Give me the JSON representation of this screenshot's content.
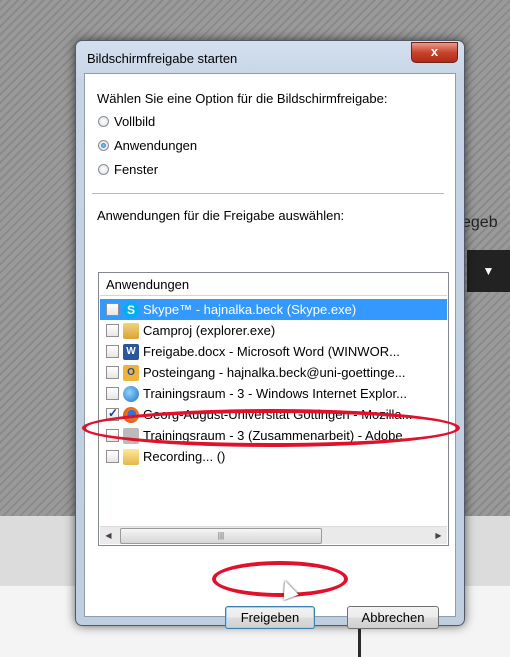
{
  "background": {
    "partial_label": "egeb"
  },
  "dialog": {
    "title": "Bildschirmfreigabe starten",
    "close_glyph": "x",
    "option_prompt": "Wählen Sie eine Option für die Bildschirmfreigabe:",
    "options": [
      {
        "label": "Vollbild",
        "selected": false
      },
      {
        "label": "Anwendungen",
        "selected": true
      },
      {
        "label": "Fenster",
        "selected": false
      }
    ],
    "apps_prompt": "Anwendungen für die Freigabe auswählen:",
    "list": {
      "header": "Anwendungen",
      "items": [
        {
          "label": "Skype™ - hajnalka.beck (Skype.exe)",
          "checked": false,
          "selected": true,
          "icon": "skype-icon"
        },
        {
          "label": "Camproj (explorer.exe)",
          "checked": false,
          "selected": false,
          "icon": "folder-icon"
        },
        {
          "label": "Freigabe.docx - Microsoft Word (WINWOR...",
          "checked": false,
          "selected": false,
          "icon": "word-icon"
        },
        {
          "label": "Posteingang - hajnalka.beck@uni-goettinge...",
          "checked": false,
          "selected": false,
          "icon": "outlook-icon"
        },
        {
          "label": "Trainingsraum - 3 - Windows Internet Explor...",
          "checked": false,
          "selected": false,
          "icon": "internet-explorer-icon"
        },
        {
          "label": "Georg-August-Universität Göttingen - Mozilla...",
          "checked": true,
          "selected": false,
          "icon": "firefox-icon"
        },
        {
          "label": "Trainingsraum - 3 (Zusammenarbeit) - Adobe...",
          "checked": false,
          "selected": false,
          "icon": "adobe-icon"
        },
        {
          "label": "Recording... ()",
          "checked": false,
          "selected": false,
          "icon": "folder-icon"
        }
      ]
    },
    "buttons": {
      "share": "Freigeben",
      "cancel": "Abbrechen"
    }
  },
  "colors": {
    "selection": "#3399ff",
    "annotation": "#e2112b"
  }
}
